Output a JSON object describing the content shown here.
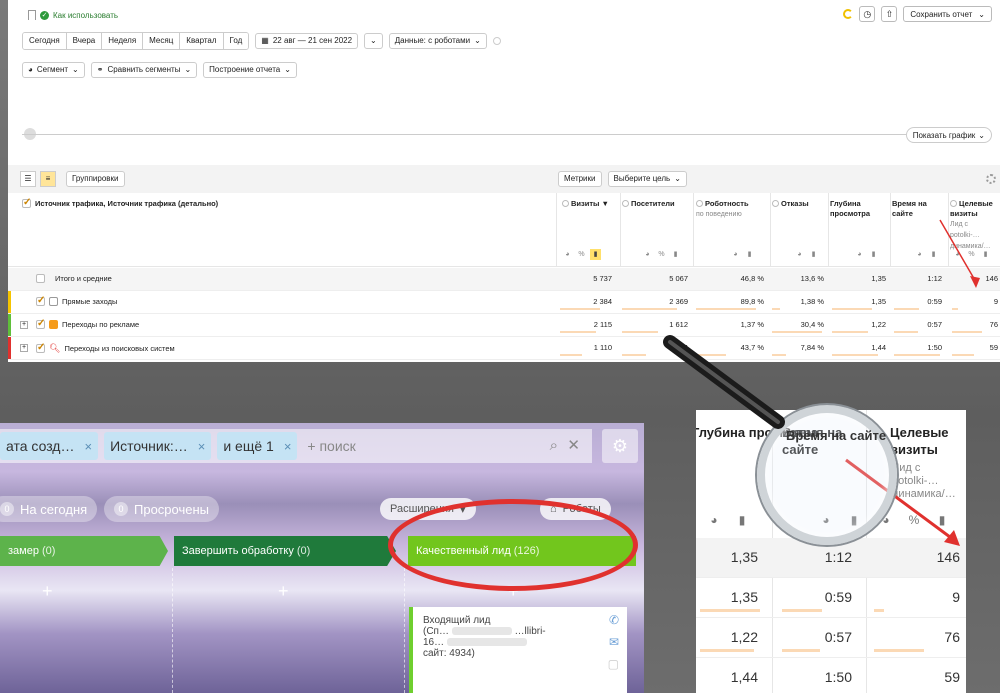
{
  "report": {
    "help_link": "Как использовать",
    "save_report": "Сохранить отчет",
    "periods": [
      "Сегодня",
      "Вчера",
      "Неделя",
      "Месяц",
      "Квартал",
      "Год"
    ],
    "date_range": "22 авг — 21 сен 2022",
    "data_mode": "Данные: с роботами",
    "segment": "Сегмент",
    "compare_segments": "Сравнить сегменты",
    "build_report": "Построение отчета",
    "show_graph": "Показать график",
    "groupings": "Группировки",
    "metrics": "Метрики",
    "select_goal": "Выберите цель",
    "dimension_title": "Источник трафика, Источник трафика (детально)",
    "columns": [
      {
        "title": "Визиты",
        "sub": "",
        "sort": "▼"
      },
      {
        "title": "Посетители",
        "sub": ""
      },
      {
        "title": "Роботность",
        "sub": "по поведению"
      },
      {
        "title": "Отказы",
        "sub": ""
      },
      {
        "title": "Глубина просмотра",
        "sub": ""
      },
      {
        "title": "Время на сайте",
        "sub": ""
      },
      {
        "title": "Целевые визиты",
        "sub": "Лид с potolki-… динамика/…"
      }
    ],
    "rows": [
      {
        "label": "Итого и средние",
        "values": [
          "5 737",
          "5 067",
          "46,8 %",
          "13,6 %",
          "1,35",
          "1:12",
          "146"
        ]
      },
      {
        "label": "Прямые заходы",
        "values": [
          "2 384",
          "2 369",
          "89,8 %",
          "1,38 %",
          "1,35",
          "0:59",
          "9"
        ],
        "color": "#f5c400"
      },
      {
        "label": "Переходы по рекламе",
        "values": [
          "2 115",
          "1 612",
          "1,37 %",
          "30,4 %",
          "1,22",
          "0:57",
          "76"
        ],
        "color": "#5fbf3a"
      },
      {
        "label": "Переходы из поисковых систем",
        "values": [
          "1 110",
          "1 024",
          "43,7 %",
          "7,84 %",
          "1,44",
          "1:50",
          "59"
        ],
        "color": "#e0312e"
      }
    ]
  },
  "crm": {
    "filters": [
      {
        "label": "ата созд…",
        "close": "×"
      },
      {
        "label": "Источник:…",
        "close": "×"
      },
      {
        "label": "и ещё 1",
        "close": "×"
      }
    ],
    "search_placeholder": "+ поиск",
    "today": {
      "count": "0",
      "label": "На сегодня"
    },
    "overdue": {
      "count": "0",
      "label": "Просрочены"
    },
    "expand_label": "Расширения",
    "robots_label": "Роботы",
    "stages": [
      {
        "title": "замер",
        "count": "(0)",
        "color": "#5db34b"
      },
      {
        "title": "Завершить обработку",
        "count": "(0)",
        "color": "#1f7a3b"
      },
      {
        "title": "Качественный лид",
        "count": "(126)",
        "color": "#72c61d"
      }
    ],
    "add_symbol": "+",
    "card": {
      "line1": "Входящий лид",
      "line2": "(Сп…",
      "line3": "…llibri-",
      "line4": "16…",
      "line5": "сайт: 4934)"
    }
  },
  "zoom": {
    "headers": [
      "Глубина просмотра",
      "Время на сайте",
      "Целевые визиты"
    ],
    "goal_sub": "Лид с potolki-… динамика/…",
    "rows": [
      [
        "1,35",
        "1:12",
        "146"
      ],
      [
        "1,35",
        "0:59",
        "9"
      ],
      [
        "1,22",
        "0:57",
        "76"
      ],
      [
        "1,44",
        "1:50",
        "59"
      ]
    ]
  },
  "colors": {
    "accent": "#e0312e",
    "highlight": "#ffe06b",
    "bar": "#fbd9b5"
  }
}
